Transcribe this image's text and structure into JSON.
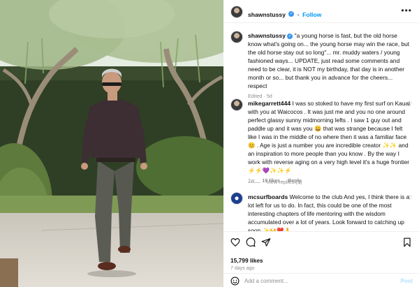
{
  "post": {
    "username": "shawnstussy",
    "follow_label": "Follow",
    "separator": "•",
    "more_icon": "more-icon"
  },
  "caption": {
    "username": "shawnstussy",
    "text": "\"a young horse is fast, but the old horse know what's going on... the young horse may win the race, but the old horse stay out so long\"... mr. muddy waters / young fashioned ways... UPDATE, just read some comments and need to be clear, it is NOT my birthday, that day is in another month or so... but thank you in advance for the cheers... respect",
    "meta": "Edited · 5d"
  },
  "comments": [
    {
      "username": "mikegarrett444",
      "text": "I was so stoked to have my first surf on Kauai with you at Waicocos . It was just me and you no one around perfect glassy sunny midmorning lefts . I saw 1 guy out and paddle up and it was you 😀 that was strange because I felt like I was in the middle of no where then it was a familiar face 😊 . Age is just a number you are incredible creator ✨✨ and an inspiration to more people than you know . By the way I work with reverse aging on a very high level it's a huge frontier ⚡⚡💜✨✨⚡",
      "time": "1w",
      "likes": "19 likes",
      "reply_label": "Reply",
      "view_replies": "View replies (1)"
    },
    {
      "username": "mcsurfboards",
      "text": "Welcome to the club And yes, I think there is a lot left for us to do. In fact, this could be one of the most interesting chapters of life mentoring with the wisdom accumulated over a lot of years. Look forward to catching up soon ✨🙌❤️🙏"
    }
  ],
  "actions": {
    "like_icon": "heart-icon",
    "comment_icon": "comment-icon",
    "share_icon": "share-icon",
    "save_icon": "bookmark-icon",
    "likes": "15,799 likes",
    "posted": "7 days ago"
  },
  "add_comment": {
    "placeholder": "Add a comment...",
    "post_label": "Post",
    "emoji_icon": "smiley-icon"
  },
  "colors": {
    "link_blue": "#0095f6",
    "verified": "#3897f0",
    "muted": "#8e8e8e"
  }
}
